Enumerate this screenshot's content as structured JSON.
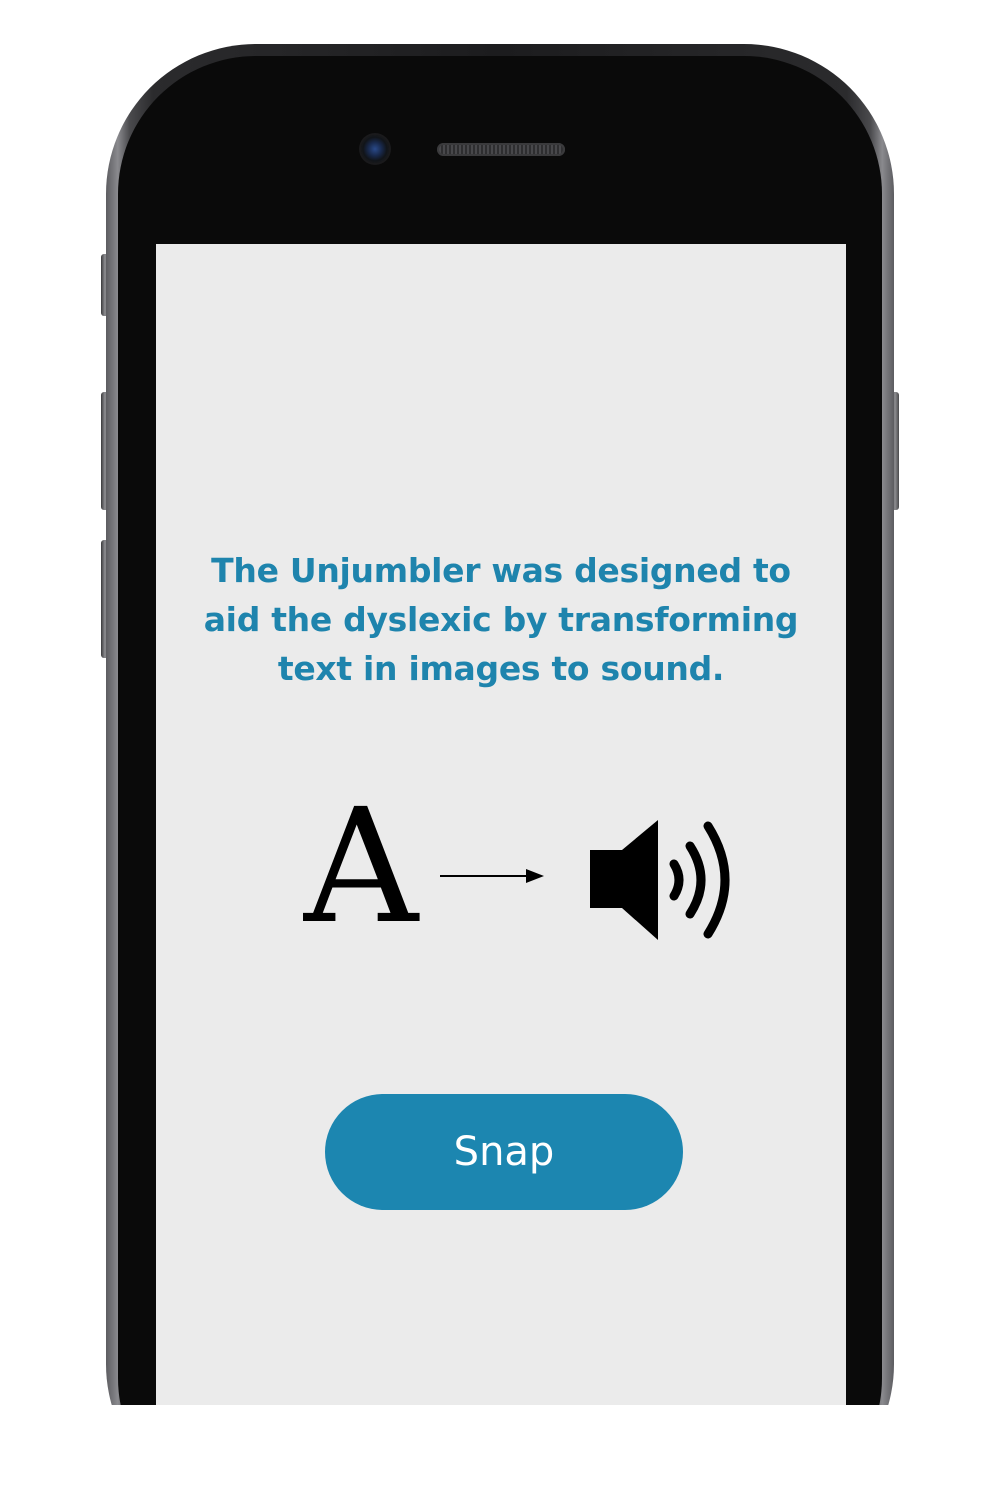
{
  "screen": {
    "background": "#ebebeb",
    "description_lines": [
      "The Unjumbler was designed to",
      "aid the dyslexic by transforming",
      "text in images to sound."
    ],
    "description_color": "#1e84ad",
    "illustration": {
      "letter": "A",
      "arrow_icon": "right-arrow-icon",
      "sound_icon": "speaker-volume-icon"
    },
    "snap_button": {
      "label": "Snap",
      "color": "#1c86b0"
    }
  }
}
